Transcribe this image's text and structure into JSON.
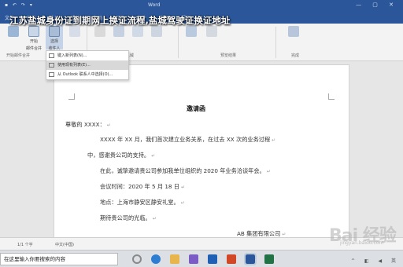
{
  "headline": "江苏盐城身份证到期网上换证流程,盐城驾驶证换证地址",
  "window": {
    "title": "Word",
    "quick_access": "▪ ↶ ↷ ▾",
    "controls": "— ▢ ✕"
  },
  "ribbon": {
    "tabs": [
      "文件",
      "开始",
      "插入",
      "设计",
      "布局",
      "引用",
      "邮件",
      "审阅",
      "视图"
    ],
    "buttons": [
      "开始",
      "选择",
      "",
      "",
      "",
      "",
      "",
      "",
      "",
      "",
      ""
    ],
    "button_sub": [
      "邮件合并",
      "收件人",
      "",
      "",
      "",
      "",
      "",
      "",
      "",
      "",
      ""
    ],
    "group_labels": [
      "开始邮件合并",
      "编写和插入域",
      "预览结果",
      "完成"
    ]
  },
  "dropdown": {
    "items": [
      "键入新列表(N)...",
      "使用现有列表(E)...",
      "从 Outlook 联系人中选择(O)..."
    ]
  },
  "document": {
    "title": "邀请函",
    "salutation": "尊敬的 XXXX：",
    "para1_line1": "XXXX 年 XX 月，我们首次建立业务关系，在过去 XX 次的业务过程",
    "para1_line2": "中，感谢贵公司的支持。",
    "para2": "在此，诚挚邀请贵公司参加我单位组织的 2020 年业务洽谈年会。",
    "time": "会议时间：2020 年 5 月 18 日",
    "place": "地点：上海市静安区静安礼堂。",
    "closing": "期待贵公司的光临。",
    "signature": "AB 集团有限公司",
    "mark": "↵"
  },
  "status": {
    "page": "1/1 个字",
    "lang": "中文(中国)"
  },
  "watermark": {
    "text": "Bai 经验",
    "sub": "jingyan.baidu.com"
  },
  "taskbar": {
    "search": "在这里输入你要搜索的内容",
    "tray": "^ ◧ ◀ 英"
  },
  "colors": {
    "word_blue": "#2b579a",
    "ribbon_bg": "#f3f3f3"
  }
}
